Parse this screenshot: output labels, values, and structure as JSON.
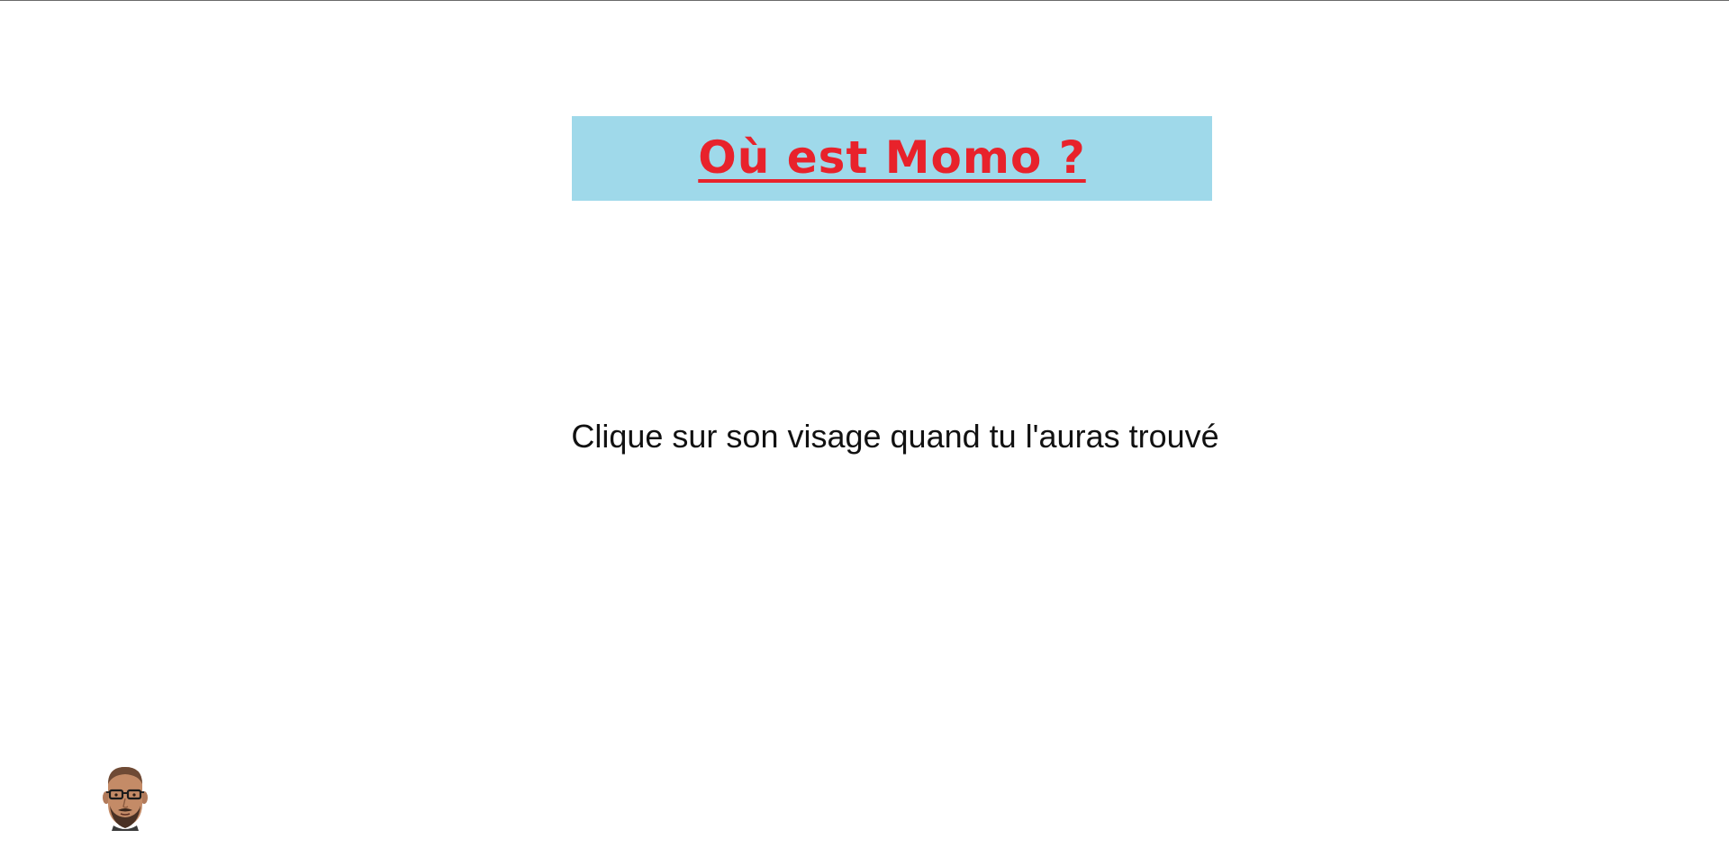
{
  "game": {
    "title": "Où est Momo ?",
    "instruction": "Clique sur son visage quand tu l'auras trouvé"
  },
  "colors": {
    "banner_background": "#9fd9ea",
    "title_color": "#e8222b",
    "text_color": "#111111",
    "page_background": "#ffffff"
  },
  "icons": {
    "target": "momo-face-icon"
  }
}
